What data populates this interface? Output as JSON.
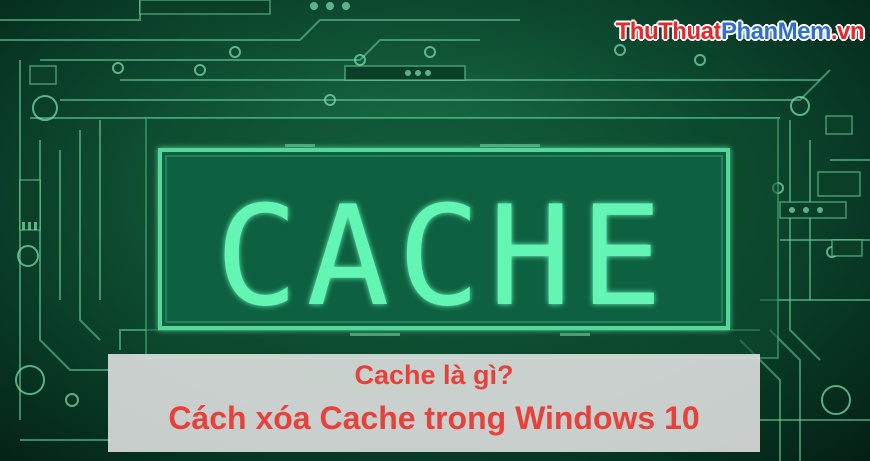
{
  "image": {
    "main_word": "CACHE",
    "watermark": {
      "part1": "ThuThuat",
      "part2": "PhanMem",
      "part3": ".vn"
    },
    "caption": {
      "line1": "Cache là gì?",
      "line2": "Cách xóa Cache trong Windows 10"
    },
    "colors": {
      "glow": "#5cf2b0",
      "background": "#0f5234",
      "caption_text": "#e8413b",
      "caption_bg": "#e4e4e4"
    }
  }
}
